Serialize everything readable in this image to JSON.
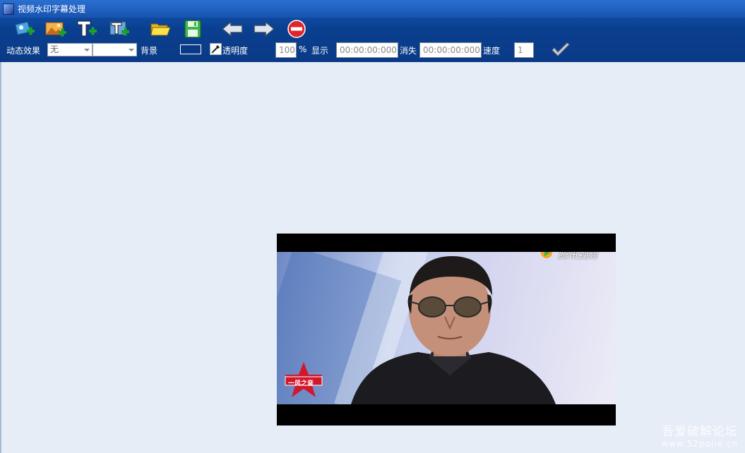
{
  "window": {
    "title": "视频水印字幕处理"
  },
  "toolbar": {
    "effect_label": "动态效果",
    "effect_value": "无",
    "effect_value2": "",
    "background_label": "背景",
    "opacity_label": "透明度",
    "opacity_value": "100",
    "percent_sign": "%",
    "show_label": "显示",
    "show_time": "00:00:00:000",
    "hide_label": "消失",
    "hide_time": "00:00:00:000",
    "speed_label": "速度",
    "speed_value": "1"
  },
  "video": {
    "watermark_text": "腾讯视频",
    "badge_text": "一风之音"
  },
  "site_watermark": {
    "line1": "吾爱破解论坛",
    "line2": "www.52pojie.cn"
  },
  "colors": {
    "titlebar": "#1853b1",
    "toolbar": "#0a3a86",
    "workspace": "#e6edf7"
  },
  "icons": [
    "add-video-icon",
    "add-image-icon",
    "add-text-icon",
    "add-text-image-icon",
    "open-folder-icon",
    "save-icon",
    "arrow-left-icon",
    "arrow-right-icon",
    "stop-icon",
    "checkmark-icon",
    "eyedropper-icon"
  ]
}
